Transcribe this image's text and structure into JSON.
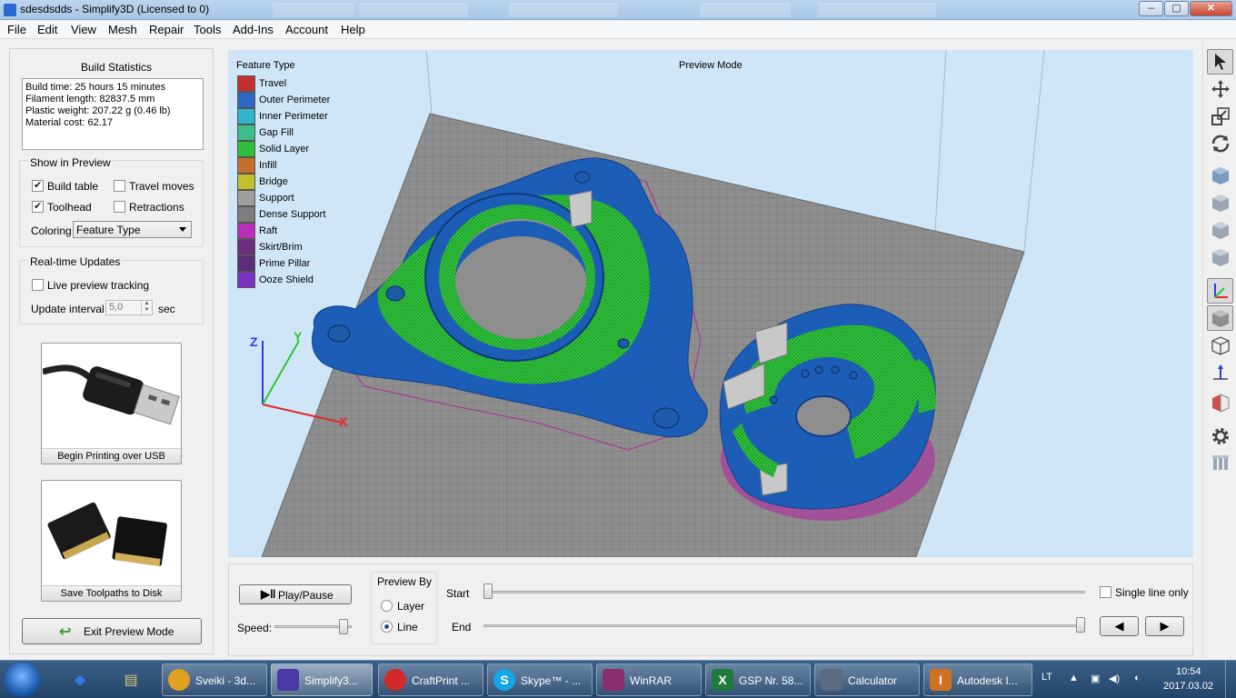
{
  "window": {
    "title": "sdesdsdds - Simplify3D (Licensed to 0)",
    "controls": {
      "minimize": "–",
      "maximize": "▢",
      "close": "✕"
    }
  },
  "menu": [
    "File",
    "Edit",
    "View",
    "Mesh",
    "Repair",
    "Tools",
    "Add-Ins",
    "Account",
    "Help"
  ],
  "left_panel": {
    "build_stats": {
      "title": "Build Statistics",
      "lines": [
        "Build time: 25 hours 15 minutes",
        "Filament length: 82837.5 mm",
        "Plastic weight: 207.22 g (0.46 lb)",
        "Material cost: 62.17"
      ]
    },
    "show_in_preview": {
      "title": "Show in Preview",
      "build_table": {
        "label": "Build table",
        "checked": true
      },
      "travel_moves": {
        "label": "Travel moves",
        "checked": false
      },
      "toolhead": {
        "label": "Toolhead",
        "checked": true
      },
      "retractions": {
        "label": "Retractions",
        "checked": false
      },
      "coloring_label": "Coloring",
      "coloring_value": "Feature Type"
    },
    "realtime": {
      "title": "Real-time Updates",
      "live_tracking": {
        "label": "Live preview tracking",
        "checked": false
      },
      "interval_label": "Update interval",
      "interval_value": "5,0",
      "interval_unit": "sec"
    },
    "usb_button": "Begin Printing over USB",
    "disk_button": "Save Toolpaths to Disk",
    "exit_button": "Exit Preview Mode"
  },
  "viewport": {
    "legend_title": "Feature Type",
    "mode_title": "Preview Mode",
    "axis_labels": {
      "z": "Z",
      "y": "Y",
      "x": "X"
    },
    "legend": [
      {
        "label": "Travel",
        "color": "#c43030"
      },
      {
        "label": "Outer Perimeter",
        "color": "#2d69c2"
      },
      {
        "label": "Inner Perimeter",
        "color": "#2fb5c8"
      },
      {
        "label": "Gap Fill",
        "color": "#3dbd8a"
      },
      {
        "label": "Solid Layer",
        "color": "#2fbd3a"
      },
      {
        "label": "Infill",
        "color": "#c86e2c"
      },
      {
        "label": "Bridge",
        "color": "#c2c02e"
      },
      {
        "label": "Support",
        "color": "#9e9e9e"
      },
      {
        "label": "Dense Support",
        "color": "#7d7d7d"
      },
      {
        "label": "Raft",
        "color": "#b92fb8"
      },
      {
        "label": "Skirt/Brim",
        "color": "#6a2d7a"
      },
      {
        "label": "Prime Pillar",
        "color": "#5b2d7a"
      },
      {
        "label": "Ooze Shield",
        "color": "#7a33c2"
      }
    ]
  },
  "toolbar_icons": [
    "select-icon",
    "move-icon",
    "scale-icon",
    "rotate-icon",
    "view-iso-icon",
    "view-front-icon",
    "view-side-icon",
    "view-top-icon",
    "axes-icon",
    "solid-view-icon",
    "wireframe-icon",
    "normals-icon",
    "cross-section-icon",
    "settings-icon",
    "supports-icon"
  ],
  "bottom": {
    "play_pause": "Play/Pause",
    "speed_label": "Speed:",
    "speed_value": 0.95,
    "preview_by_title": "Preview By",
    "layer_label": "Layer",
    "line_label": "Line",
    "selected_mode": "Line",
    "start_label": "Start",
    "end_label": "End",
    "start_value": 0.0,
    "end_value": 1.0,
    "single_line_label": "Single line only",
    "prev_icon": "◀",
    "next_icon": "▶"
  },
  "taskbar": {
    "items": [
      {
        "label": "Sveiki - 3d...",
        "icon": "chrome-icon",
        "color": "#e0a020"
      },
      {
        "label": "Simplify3...",
        "icon": "simplify3d-icon",
        "color": "#4a37a8",
        "active": true
      },
      {
        "label": "CraftPrint ...",
        "icon": "craftprint-icon",
        "color": "#d02a2a"
      },
      {
        "label": "Skype™ - ...",
        "icon": "skype-icon",
        "color": "#16a5e8"
      },
      {
        "label": "WinRAR",
        "icon": "winrar-icon",
        "color": "#8a2e6e"
      },
      {
        "label": "GSP Nr. 58...",
        "icon": "excel-icon",
        "color": "#1e7b3a"
      },
      {
        "label": "Calculator",
        "icon": "calculator-icon",
        "color": "#5a6a80"
      },
      {
        "label": "Autodesk I...",
        "icon": "autodesk-icon",
        "color": "#d07020"
      }
    ],
    "language": "LT",
    "time": "10:54",
    "date": "2017.03.02"
  }
}
